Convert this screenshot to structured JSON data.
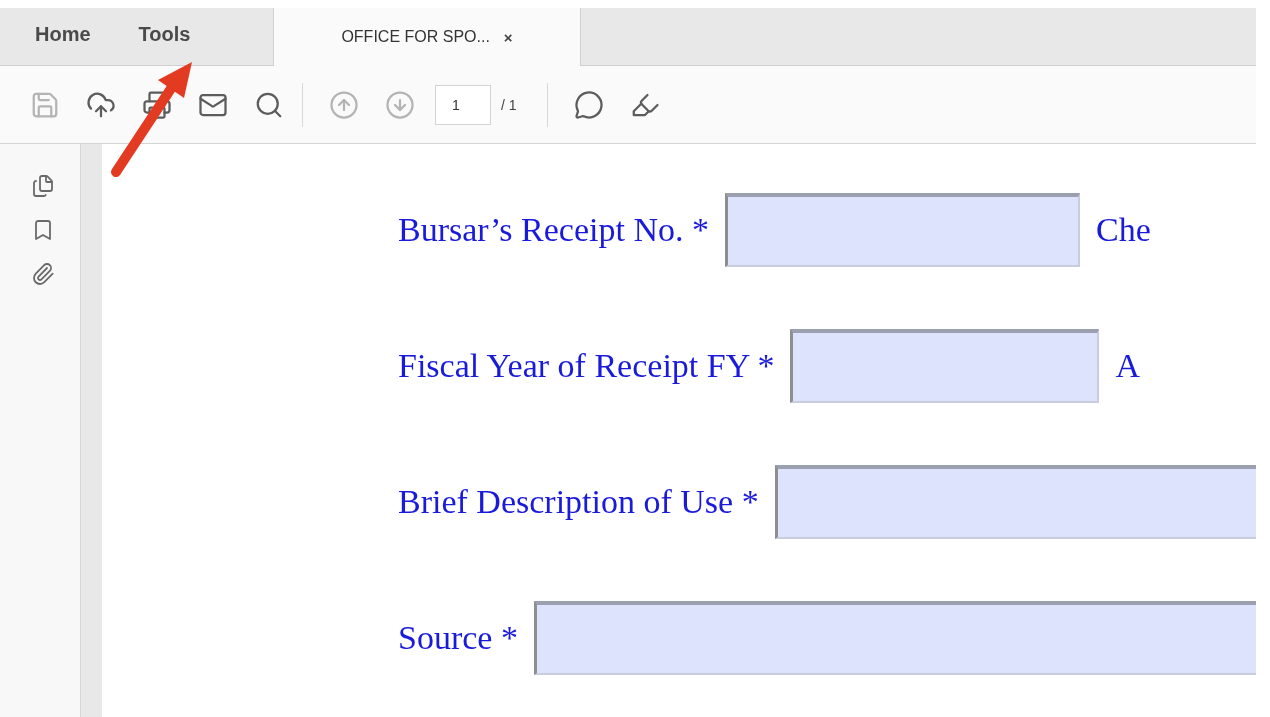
{
  "nav": [
    {
      "label": "Home"
    },
    {
      "label": "Tools"
    }
  ],
  "tabs": [
    {
      "label": "OFFICE FOR SPO...",
      "close": "×",
      "selected": true
    }
  ],
  "toolbar": [
    {
      "kind": "save",
      "disabled": true
    },
    {
      "kind": "upload",
      "disabled": false
    },
    {
      "kind": "print",
      "disabled": false
    },
    {
      "kind": "mail",
      "disabled": false
    },
    {
      "kind": "search",
      "disabled": false
    },
    {
      "kind": "separator"
    },
    {
      "kind": "prev",
      "disabled": true
    },
    {
      "kind": "next",
      "disabled": true
    },
    {
      "kind": "page",
      "value": "1",
      "total": "/ 1"
    },
    {
      "kind": "separator"
    },
    {
      "kind": "comment",
      "disabled": false
    },
    {
      "kind": "highlight",
      "disabled": false
    }
  ],
  "side_panel": [
    {
      "kind": "pages"
    },
    {
      "kind": "bookmark"
    },
    {
      "kind": "attachment"
    }
  ],
  "form": {
    "fields": [
      {
        "label": "Bursar’s Receipt No. *",
        "trailing": "Che"
      },
      {
        "label": "Fiscal Year of Receipt FY *",
        "trailing": "A"
      },
      {
        "label": "Brief Description of Use *"
      },
      {
        "label": "Source *"
      }
    ]
  }
}
